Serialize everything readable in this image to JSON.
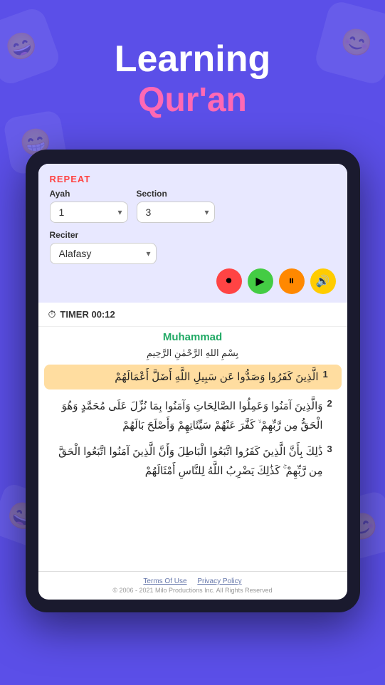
{
  "background_color": "#5B4FE8",
  "header": {
    "title": "Learning",
    "subtitle": "Qur'an"
  },
  "controls": {
    "repeat_label": "REPEAT",
    "ayah_label": "Ayah",
    "ayah_value": "1",
    "section_label": "Section",
    "section_value": "3",
    "reciter_label": "Reciter",
    "reciter_value": "Alafasy"
  },
  "playback": {
    "buttons": [
      {
        "id": "record",
        "color": "#FF4444",
        "icon": "⏺"
      },
      {
        "id": "play",
        "color": "#44CC44",
        "icon": "▶"
      },
      {
        "id": "pause",
        "color": "#FF8800",
        "icon": "⏸"
      },
      {
        "id": "volume",
        "color": "#FFCC00",
        "icon": "🔊"
      }
    ]
  },
  "timer": {
    "label": "TIMER 00:12",
    "icon": "⏱"
  },
  "surah": {
    "name": "Muhammad",
    "bismillah": "بِسْمِ اللهِ الرَّحْمٰنِ الرَّحِيمِ",
    "ayahs": [
      {
        "number": "1",
        "text": "الَّذِينَ كَفَرُوا وَصَدُّوا عَن سَبِيلِ اللَّهُ أَضَلَّ أَعْمَالَهُمْ",
        "highlighted": true
      },
      {
        "number": "2",
        "text": "وَالَّذِينَ آمَنُوا وَعَمِلُوا الصَّالِحَاتِ وَآمَنُوا بِمَا نُزِّلَ عَلَى مُحَمَّدٍ وَهُوَ الْحَقُّ مِن رَّبِّهِمْ ۙ كَفَّرَ عَنْهُمْ سَيِّئَاتِهِمْ وَأَصْلَحَ بَالَهُمْ",
        "highlighted": false
      },
      {
        "number": "3",
        "text": "ذَٰلِكَ بِأَنَّ الَّذِينَ كَفَرُوا اتَّبَعُوا الْبَاطِلَ وَأَنَّ الَّذِينَ آمَنُوا اتَّبَعُوا الْحَقَّ مِن رَّبِّهِمْ ۚ كَذَٰلِكَ يَضْرِبُ اللَّهُ لِلنَّاسِ أَمْثَالَهُمْ",
        "highlighted": false
      }
    ]
  },
  "footer": {
    "terms_label": "Terms Of Use",
    "privacy_label": "Privacy Policy",
    "copyright": "© 2006 - 2021 Milo Productions Inc. All Rights Reserved"
  },
  "decorations": [
    {
      "emoji": "😄",
      "class": "bg-deco-1"
    },
    {
      "emoji": "😊",
      "class": "bg-deco-2"
    },
    {
      "emoji": "😁",
      "class": "bg-deco-3"
    },
    {
      "emoji": "😄",
      "class": "bg-deco-4"
    },
    {
      "emoji": "😊",
      "class": "bg-deco-5"
    }
  ]
}
